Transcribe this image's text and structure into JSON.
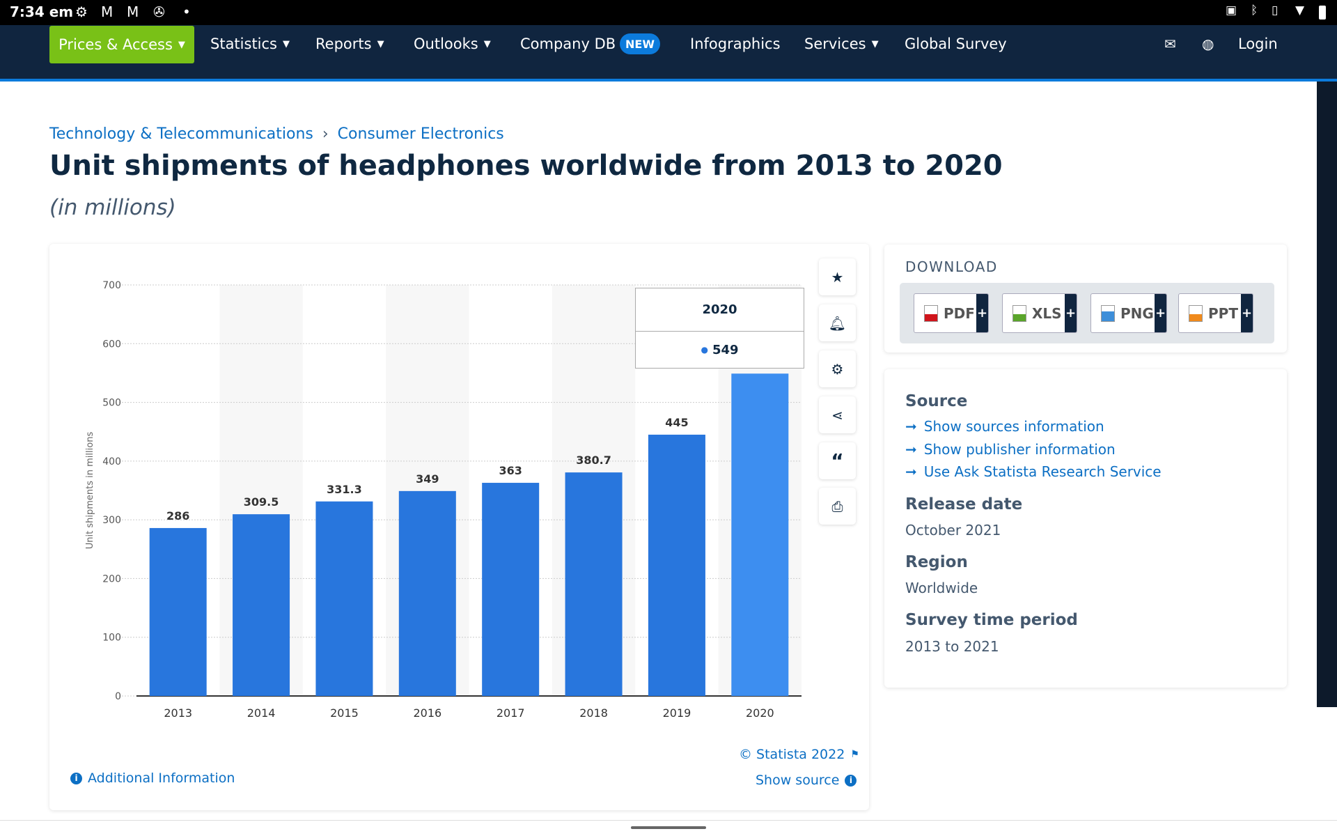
{
  "status_bar": {
    "time": "7:34 em",
    "icons": [
      "gear-icon",
      "gmail-icon",
      "gmail-icon",
      "aperture-icon",
      "dot-icon"
    ],
    "right_icons": [
      "cast-icon",
      "bluetooth-icon",
      "vibrate-icon",
      "wifi-icon",
      "battery-icon"
    ]
  },
  "nav": {
    "items": [
      {
        "label": "Prices & Access",
        "dropdown": true
      },
      {
        "label": "Statistics",
        "dropdown": true
      },
      {
        "label": "Reports",
        "dropdown": true
      },
      {
        "label": "Outlooks",
        "dropdown": true
      },
      {
        "label": "Company DB",
        "dropdown": false
      },
      {
        "label": "Infographics",
        "dropdown": false
      },
      {
        "label": "Services",
        "dropdown": true
      },
      {
        "label": "Global Survey",
        "dropdown": false
      }
    ],
    "new_badge": "NEW",
    "login": "Login",
    "accent": "#79c117",
    "bg": "#10253f"
  },
  "breadcrumb": {
    "items": [
      "Technology & Telecommunications",
      "Consumer Electronics"
    ],
    "separator": "›"
  },
  "page": {
    "title": "Unit shipments of headphones worldwide from 2013 to 2020",
    "subtitle": "(in millions)"
  },
  "chart_data": {
    "type": "bar",
    "categories": [
      "2013",
      "2014",
      "2015",
      "2016",
      "2017",
      "2018",
      "2019",
      "2020"
    ],
    "values": [
      286,
      309.5,
      331.3,
      349,
      363,
      380.7,
      445,
      549
    ],
    "data_labels": [
      "286",
      "309.5",
      "331.3",
      "349",
      "363",
      "380.7",
      "445",
      ""
    ],
    "ylabel": "Unit shipments in millions",
    "xlabel": "",
    "ylim": [
      0,
      700
    ],
    "yticks": [
      0,
      100,
      200,
      300,
      400,
      500,
      600,
      700
    ],
    "grid": true,
    "bar_color": "#2876dd",
    "highlight_color": "#3d8ef0",
    "highlighted": "2020",
    "tooltip": {
      "title": "2020",
      "value": "549"
    }
  },
  "chart_footer": {
    "copyright": "© Statista 2022",
    "show_source": "Show source",
    "additional_info": "Additional Information"
  },
  "side_tools": [
    "star-icon",
    "bell-icon",
    "gear-icon",
    "share-icon",
    "quote-icon",
    "print-icon"
  ],
  "download": {
    "heading": "DOWNLOAD",
    "buttons": [
      {
        "label": "PDF",
        "color": "#d0141b"
      },
      {
        "label": "XLS",
        "color": "#5aa52a"
      },
      {
        "label": "PNG",
        "color": "#3d8ed9"
      },
      {
        "label": "PPT",
        "color": "#f08a1c"
      }
    ],
    "plus": "+"
  },
  "source": {
    "heading": "Source",
    "links": [
      "Show sources information",
      "Show publisher information",
      "Use Ask Statista Research Service"
    ],
    "release_label": "Release date",
    "release": "October 2021",
    "region_label": "Region",
    "region": "Worldwide",
    "period_label": "Survey time period",
    "period": "2013 to 2021"
  }
}
